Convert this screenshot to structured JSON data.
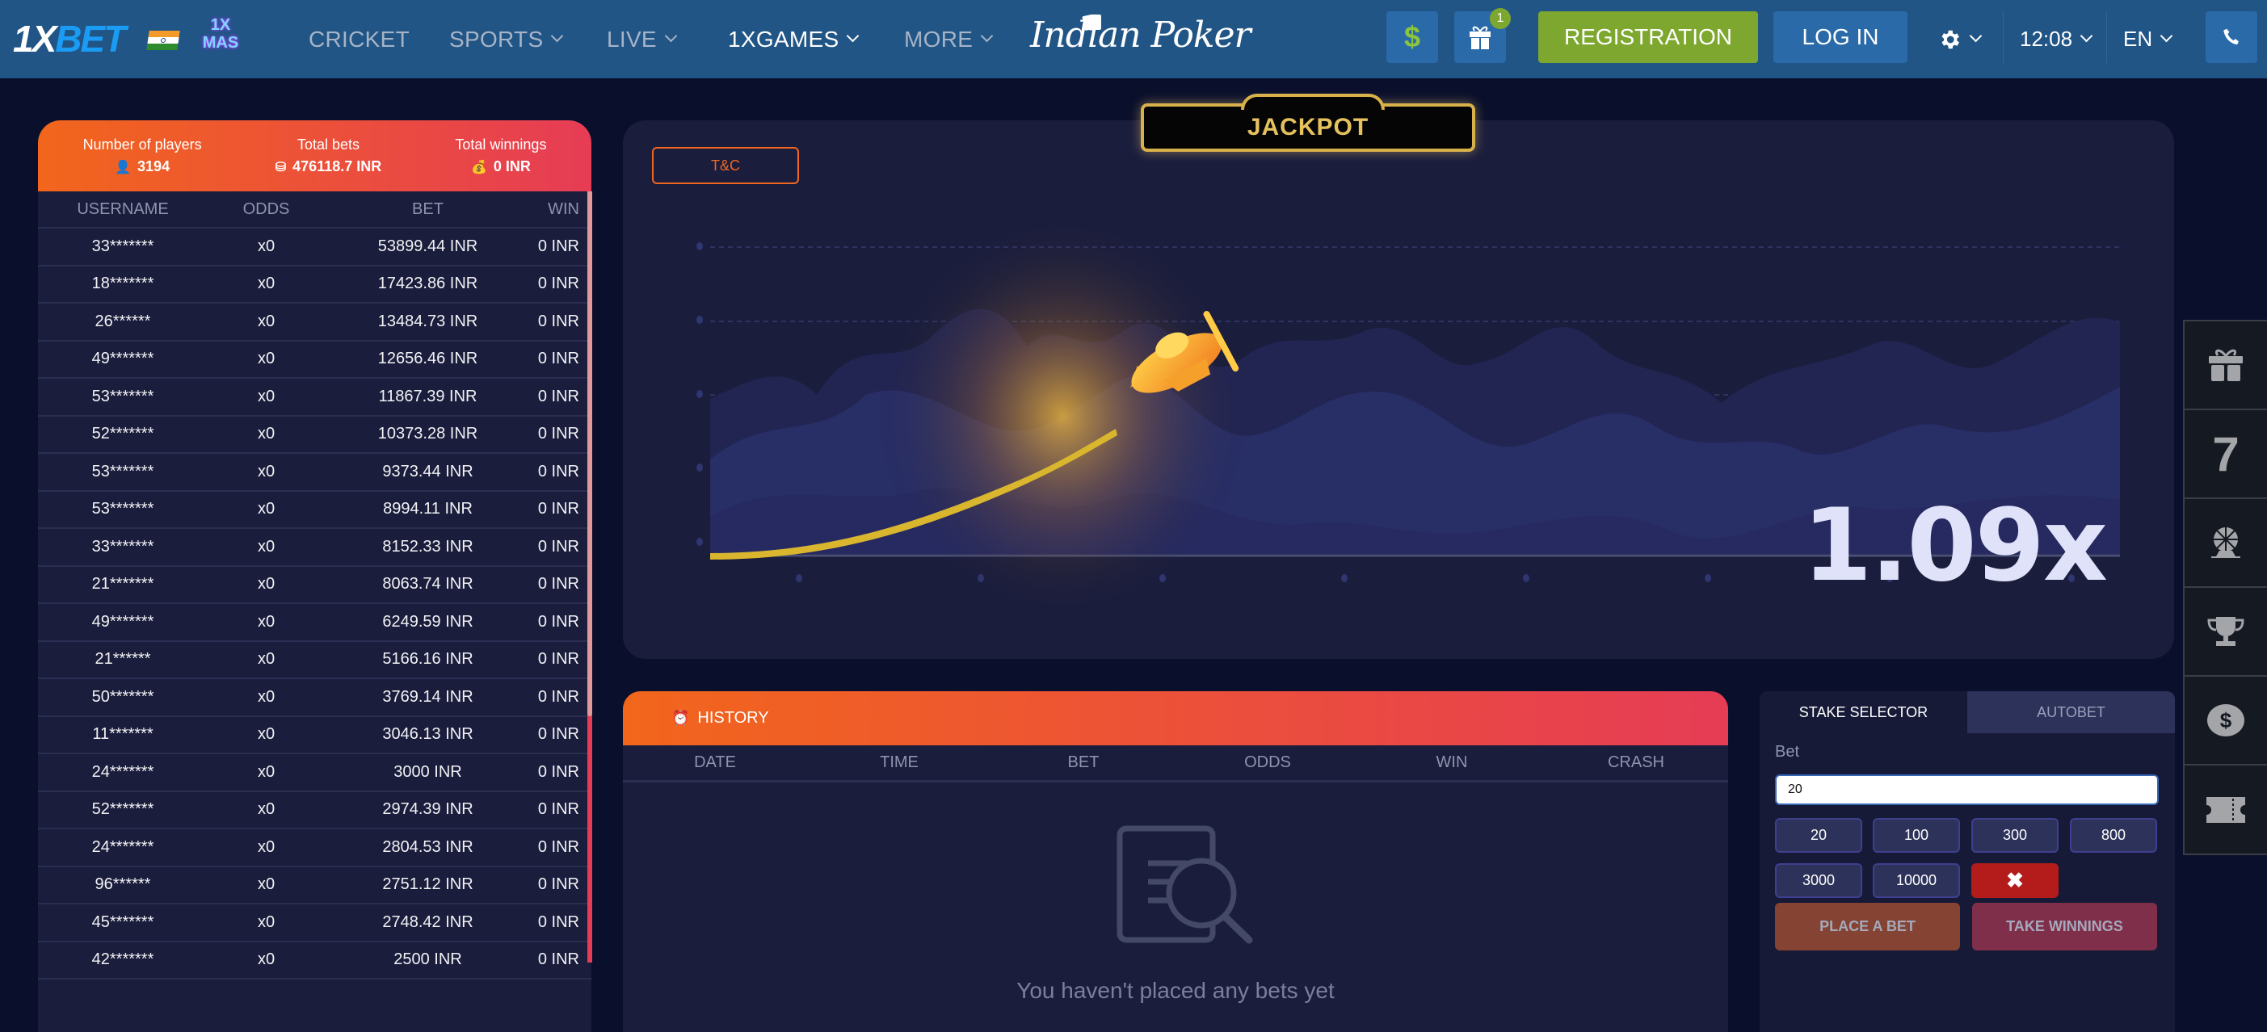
{
  "header": {
    "logo_a": "1X",
    "logo_b": "BET",
    "xmas_line1": "1X",
    "xmas_line2": "MAS",
    "nav": [
      {
        "label": "CRICKET",
        "dropdown": false,
        "active": false
      },
      {
        "label": "SPORTS",
        "dropdown": true,
        "active": false
      },
      {
        "label": "LIVE",
        "dropdown": true,
        "active": false
      },
      {
        "label": "1XGAMES",
        "dropdown": true,
        "active": true
      },
      {
        "label": "MORE",
        "dropdown": true,
        "active": false
      }
    ],
    "promo_logo": "Indian Poker",
    "deposit_icon": "dollar-icon",
    "gift_badge": "1",
    "registration_label": "REGISTRATION",
    "login_label": "LOG IN",
    "settings_icon": "gear-icon",
    "time": "12:08",
    "language": "EN",
    "phone_icon": "phone-icon"
  },
  "stats": {
    "players_label": "Number of players",
    "players_value": "3194",
    "bets_label": "Total bets",
    "bets_value": "476118.7 INR",
    "winnings_label": "Total winnings",
    "winnings_value": "0 INR"
  },
  "bets_table": {
    "columns": [
      "USERNAME",
      "ODDS",
      "BET",
      "WIN"
    ],
    "rows": [
      [
        "33*******",
        "x0",
        "53899.44 INR",
        "0 INR"
      ],
      [
        "18*******",
        "x0",
        "17423.86 INR",
        "0 INR"
      ],
      [
        "26******",
        "x0",
        "13484.73 INR",
        "0 INR"
      ],
      [
        "49*******",
        "x0",
        "12656.46 INR",
        "0 INR"
      ],
      [
        "53*******",
        "x0",
        "11867.39 INR",
        "0 INR"
      ],
      [
        "52*******",
        "x0",
        "10373.28 INR",
        "0 INR"
      ],
      [
        "53*******",
        "x0",
        "9373.44 INR",
        "0 INR"
      ],
      [
        "53*******",
        "x0",
        "8994.11 INR",
        "0 INR"
      ],
      [
        "33*******",
        "x0",
        "8152.33 INR",
        "0 INR"
      ],
      [
        "21*******",
        "x0",
        "8063.74 INR",
        "0 INR"
      ],
      [
        "49*******",
        "x0",
        "6249.59 INR",
        "0 INR"
      ],
      [
        "21******",
        "x0",
        "5166.16 INR",
        "0 INR"
      ],
      [
        "50*******",
        "x0",
        "3769.14 INR",
        "0 INR"
      ],
      [
        "11*******",
        "x0",
        "3046.13 INR",
        "0 INR"
      ],
      [
        "24*******",
        "x0",
        "3000 INR",
        "0 INR"
      ],
      [
        "52*******",
        "x0",
        "2974.39 INR",
        "0 INR"
      ],
      [
        "24*******",
        "x0",
        "2804.53 INR",
        "0 INR"
      ],
      [
        "96******",
        "x0",
        "2751.12 INR",
        "0 INR"
      ],
      [
        "45*******",
        "x0",
        "2748.42 INR",
        "0 INR"
      ],
      [
        "42*******",
        "x0",
        "2500 INR",
        "0 INR"
      ]
    ]
  },
  "game": {
    "tc_label": "T&C",
    "jackpot_label": "JACKPOT",
    "multiplier": "1.09x"
  },
  "history": {
    "title": "HISTORY",
    "columns": [
      "DATE",
      "TIME",
      "BET",
      "ODDS",
      "WIN",
      "CRASH"
    ],
    "empty_message": "You haven't placed any bets yet"
  },
  "stake": {
    "tabs": [
      {
        "label": "STAKE SELECTOR",
        "active": true
      },
      {
        "label": "AUTOBET",
        "active": false
      }
    ],
    "bet_label": "Bet",
    "bet_value": "20",
    "chips": [
      "20",
      "100",
      "300",
      "800",
      "3000",
      "10000"
    ],
    "clear_symbol": "✖",
    "place_bet_label": "PLACE A BET",
    "take_winnings_label": "TAKE WINNINGS"
  },
  "right_sidebar": {
    "items": [
      {
        "icon": "gift-icon"
      },
      {
        "icon": "lucky-seven-icon",
        "text": "7"
      },
      {
        "icon": "wheel-of-fortune-icon"
      },
      {
        "icon": "trophy-icon"
      },
      {
        "icon": "dollar-coin-icon"
      },
      {
        "icon": "ticket-icon"
      }
    ]
  },
  "colors": {
    "header_bg": "#215585",
    "page_bg": "#0a0f2b",
    "panel_bg": "#1a1d3c",
    "accent_orange": "#f2661c",
    "accent_red": "#e63c55",
    "registration_green": "#7da72e",
    "flight_line": "#d9b62e"
  }
}
